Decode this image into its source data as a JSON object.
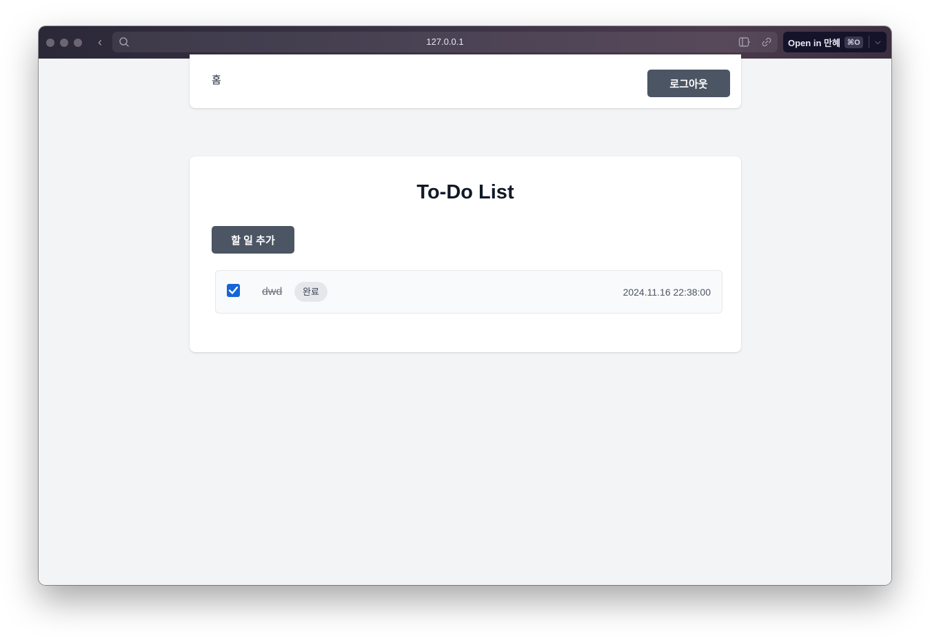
{
  "browser": {
    "url": "127.0.0.1",
    "open_in_label": "Open in 만혜",
    "open_in_shortcut": "⌘O"
  },
  "nav": {
    "home_label": "홈",
    "logout_label": "로그아웃"
  },
  "main": {
    "title": "To-Do List",
    "add_button_label": "할 일 추가",
    "todos": [
      {
        "text": "dwd",
        "completed": true,
        "status_label": "완료",
        "datetime": "2024.11.16 22:38:00"
      }
    ]
  },
  "colors": {
    "button_bg": "#4b5563",
    "page_bg": "#f3f4f6",
    "checkbox_accent": "#1565d8"
  }
}
